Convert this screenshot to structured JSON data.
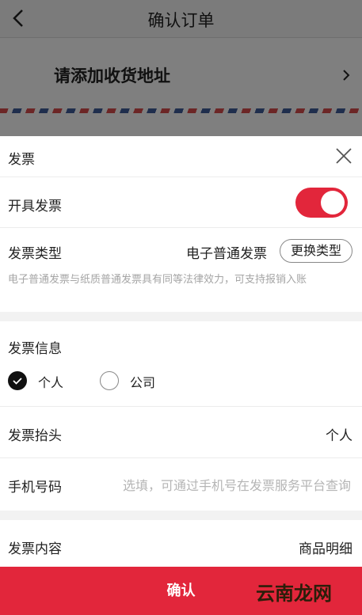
{
  "background": {
    "title": "确认订单",
    "address_prompt": "请添加收货地址"
  },
  "sheet": {
    "title": "发票",
    "toggle": {
      "label": "开具发票",
      "on": true
    },
    "invoice_type": {
      "label": "发票类型",
      "value": "电子普通发票",
      "change_button": "更换类型",
      "note": "电子普通发票与纸质普通发票具有同等法律效力，可支持报销入账"
    },
    "invoice_info": {
      "label": "发票信息",
      "options": [
        {
          "label": "个人",
          "selected": true
        },
        {
          "label": "公司",
          "selected": false
        }
      ]
    },
    "invoice_header": {
      "label": "发票抬头",
      "value": "个人"
    },
    "phone": {
      "label": "手机号码",
      "value": "",
      "placeholder": "选填，可通过手机号在发票服务平台查询"
    },
    "invoice_content": {
      "label": "发票内容",
      "value": "商品明细"
    },
    "confirm_button": "确认"
  },
  "watermark": "云南龙网",
  "colors": {
    "accent": "#e2263b",
    "overlay": "rgba(0,0,0,0.5)"
  }
}
